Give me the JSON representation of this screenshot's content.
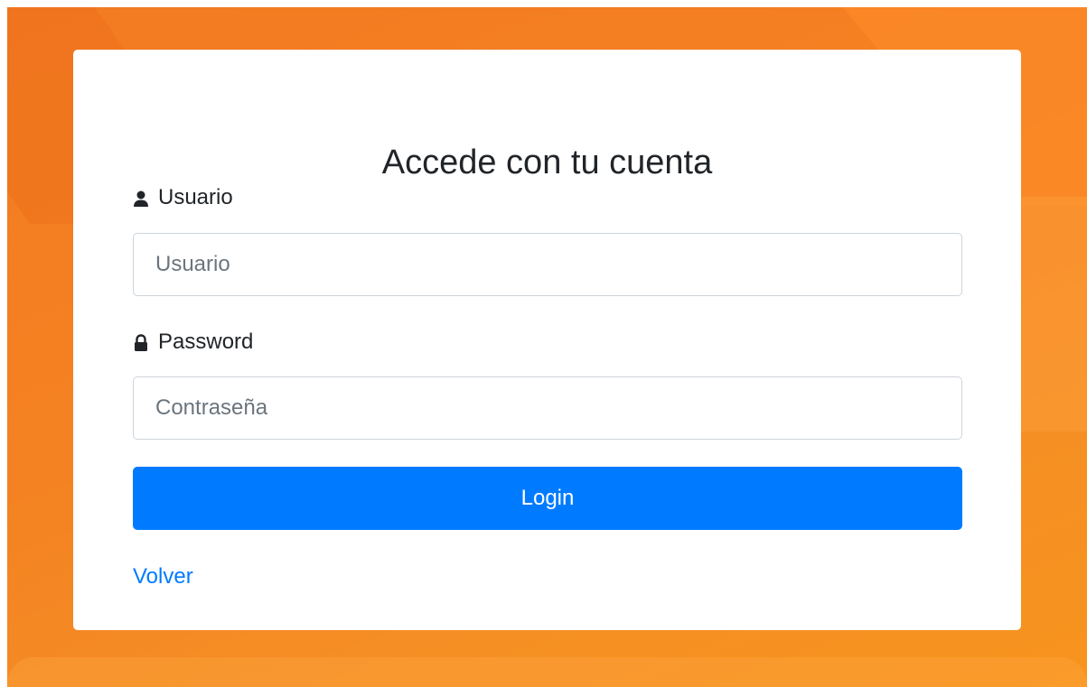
{
  "login": {
    "title": "Accede con tu cuenta",
    "username_label": "Usuario",
    "username_placeholder": "Usuario",
    "username_icon": "user-icon",
    "password_label": "Password",
    "password_placeholder": "Contraseña",
    "password_icon": "lock-icon",
    "submit_label": "Login",
    "back_link": "Volver"
  },
  "colors": {
    "background": "#f48222",
    "primary": "#007bff",
    "text": "#212529",
    "border": "#ced4da"
  }
}
